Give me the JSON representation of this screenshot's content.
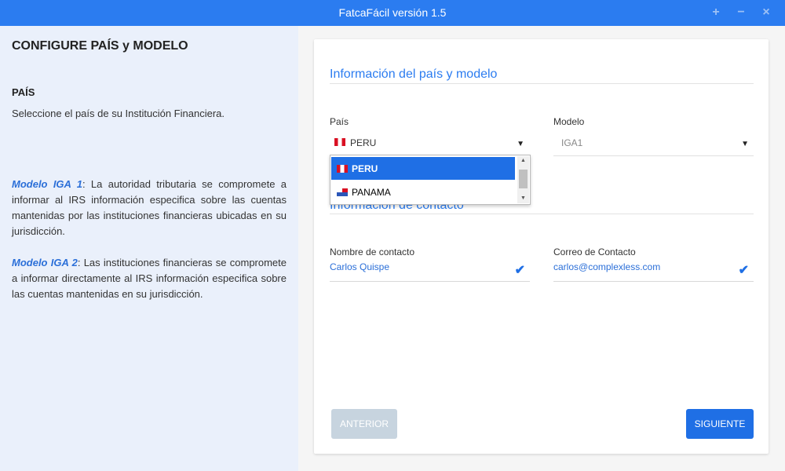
{
  "window": {
    "title": "FatcaFácil versión 1.5",
    "controls": {
      "maximize": "+",
      "minimize": "−",
      "close": "×"
    }
  },
  "sidebar": {
    "heading": "CONFIGURE PAÍS y MODELO",
    "pais_heading": "PAÍS",
    "pais_desc": "Seleccione el país de su Institución Financiera.",
    "modelo1_name": "Modelo IGA 1",
    "modelo1_text": ": La autoridad tributaria se compromete a informar al IRS información especifica sobre las cuentas mantenidas por las instituciones financieras ubicadas en su jurisdicción.",
    "modelo2_name": "Modelo IGA 2",
    "modelo2_text": ": Las instituciones financieras se compromete a informar directamente al IRS información especifica sobre las cuentas mantenidas en su jurisdicción."
  },
  "form": {
    "section_country": "Información del país y modelo",
    "section_contact": "Información de contacto",
    "pais_label": "País",
    "pais_value": "PERU",
    "modelo_label": "Modelo",
    "modelo_value": "IGA1",
    "dropdown_options": [
      "PERU",
      "PANAMA"
    ],
    "contact_name_label": "Nombre de contacto",
    "contact_name_value": "Carlos Quispe",
    "contact_email_label": "Correo de Contacto",
    "contact_email_value": "carlos@complexless.com",
    "check_glyph": "✔",
    "select_arrow": "▼"
  },
  "buttons": {
    "prev": "ANTERIOR",
    "next": "SIGUIENTE"
  },
  "colors": {
    "accent": "#2b7cf0",
    "primary_button": "#1f6fe5",
    "disabled_button": "#c7d4df",
    "sidebar_bg": "#eaf0fb"
  }
}
